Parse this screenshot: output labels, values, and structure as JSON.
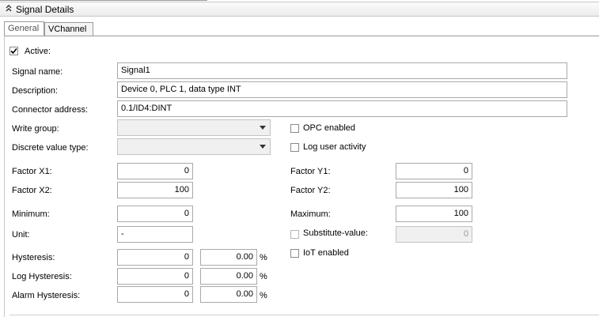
{
  "header": {
    "title": "Signal Details"
  },
  "tabs": [
    {
      "label": "General"
    },
    {
      "label": "VChannel"
    }
  ],
  "form": {
    "active": {
      "label": "Active:",
      "checked": true
    },
    "signal_name": {
      "label": "Signal name:",
      "value": "Signal1"
    },
    "description": {
      "label": "Description:",
      "value": "Device 0, PLC 1, data type INT"
    },
    "connector_address": {
      "label": "Connector address:",
      "value": "0.1/ID4:DINT"
    },
    "write_group": {
      "label": "Write group:",
      "value": ""
    },
    "discrete_value_type": {
      "label": "Discrete value type:",
      "value": ""
    },
    "opc_enabled": {
      "label": "OPC enabled",
      "checked": false
    },
    "log_user_activity": {
      "label": "Log user activity",
      "checked": false
    },
    "factor_x1": {
      "label": "Factor X1:",
      "value": "0"
    },
    "factor_x2": {
      "label": "Factor X2:",
      "value": "100"
    },
    "factor_y1": {
      "label": "Factor Y1:",
      "value": "0"
    },
    "factor_y2": {
      "label": "Factor Y2:",
      "value": "100"
    },
    "minimum": {
      "label": "Minimum:",
      "value": "0"
    },
    "maximum": {
      "label": "Maximum:",
      "value": "100"
    },
    "unit": {
      "label": "Unit:",
      "value": "-"
    },
    "substitute_value": {
      "label": "Substitute-value:",
      "checked": false,
      "value": "0"
    },
    "iot_enabled": {
      "label": "IoT enabled",
      "checked": false
    },
    "hysteresis": {
      "label": "Hysteresis:",
      "value": "0",
      "percent": "0.00"
    },
    "log_hysteresis": {
      "label": "Log Hysteresis:",
      "value": "0",
      "percent": "0.00"
    },
    "alarm_hysteresis": {
      "label": "Alarm Hysteresis:",
      "value": "0",
      "percent": "0.00"
    },
    "percent_sign": "%"
  },
  "icons": {
    "collapse": "chevron-double-up-icon",
    "dropdown": "dropdown-arrow-icon",
    "check": "checkmark-icon"
  }
}
